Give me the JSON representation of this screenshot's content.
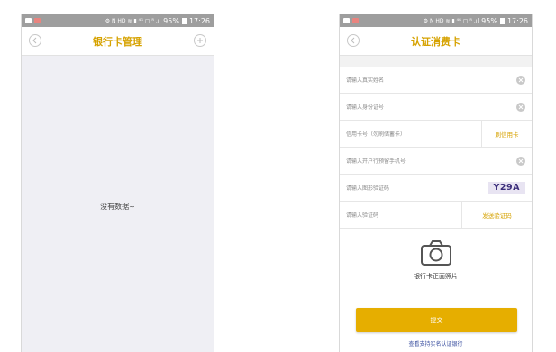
{
  "left": {
    "statusbar": {
      "icons": "⚙ N HD ≋ ▮ ⁴ᴳ ▢ ᴿ .ıl",
      "battery": "95%",
      "time": "17:26"
    },
    "navbar": {
      "title": "银行卡管理"
    },
    "empty_text": "没有数据~"
  },
  "right": {
    "statusbar": {
      "icons": "⚙ N HD ≋ ▮ ⁴ᴳ ▢ ᴿ .ıl",
      "battery": "95%",
      "time": "17:26"
    },
    "navbar": {
      "title": "认证消费卡"
    },
    "form": {
      "name_placeholder": "请输入真实姓名",
      "id_placeholder": "请输入身份证号",
      "card_placeholder": "信用卡号（勿刷储蓄卡）",
      "card_action": "刷信用卡",
      "phone_placeholder": "请输入开户行预留手机号",
      "captcha_placeholder": "请输入图形验证码",
      "captcha_code": "Y29A",
      "sms_placeholder": "请输入验证码",
      "sms_action": "发送验证码"
    },
    "photo_label": "银行卡正面照片",
    "submit_label": "提交",
    "bank_link": "查看支持实名认证银行"
  },
  "colors": {
    "accent": "#e6ae00",
    "title": "#d6a200",
    "link": "#3a4fa0"
  }
}
